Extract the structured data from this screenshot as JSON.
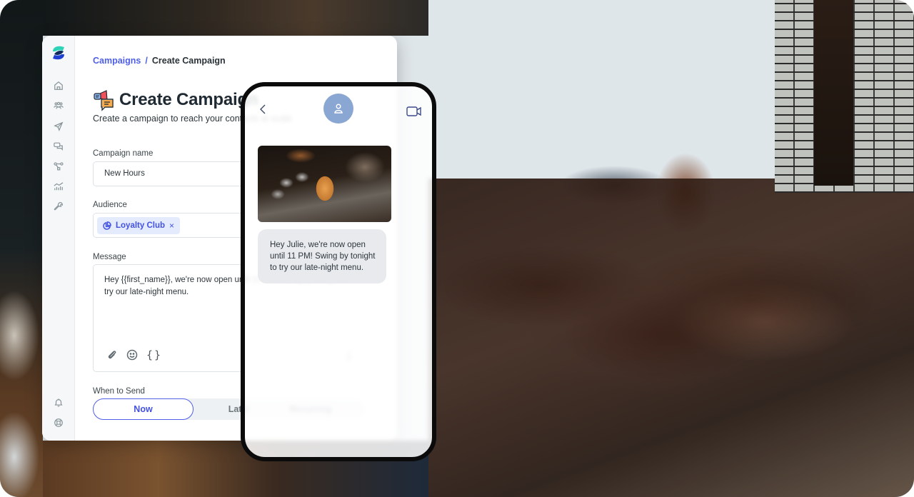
{
  "app": {
    "brand_colors": {
      "accent": "#4f5fe8",
      "logo_teal": "#2ed3b7",
      "logo_navy": "#1f3fd1"
    }
  },
  "sidebar": {
    "top_items": [
      {
        "name": "home",
        "icon": "home-icon"
      },
      {
        "name": "contacts",
        "icon": "users-icon"
      },
      {
        "name": "campaigns",
        "icon": "paper-plane-icon"
      },
      {
        "name": "conversations",
        "icon": "chat-bubbles-icon"
      },
      {
        "name": "workflows",
        "icon": "flow-icon"
      },
      {
        "name": "analytics",
        "icon": "chart-icon"
      },
      {
        "name": "tools",
        "icon": "wrench-icon"
      }
    ],
    "bottom_items": [
      {
        "name": "notifications",
        "icon": "bell-icon"
      },
      {
        "name": "help",
        "icon": "lifebuoy-icon"
      }
    ]
  },
  "breadcrumb": {
    "parent": "Campaigns",
    "separator": "/",
    "current": "Create Campaign"
  },
  "header": {
    "title": "Create Campaign",
    "subtitle": "Create a campaign to reach your contacts at scale."
  },
  "form": {
    "campaign_name": {
      "label": "Campaign name",
      "value": "New Hours"
    },
    "audience": {
      "label": "Audience",
      "chips": [
        {
          "label": "Loyalty Club",
          "remove": "×"
        }
      ]
    },
    "message": {
      "label": "Message",
      "value": "Hey {{first_name}}, we're now open until 11 PM! Swing by tonight to try our late-night menu.",
      "tools": {
        "braces": "{}"
      }
    },
    "when_to_send": {
      "label": "When to Send",
      "options": [
        "Now",
        "Later",
        "Recurring"
      ],
      "selected": "Now"
    }
  },
  "phone_preview": {
    "message_text": "Hey Julie, we're now open until 11 PM! Swing by tonight to try our late-night menu."
  }
}
